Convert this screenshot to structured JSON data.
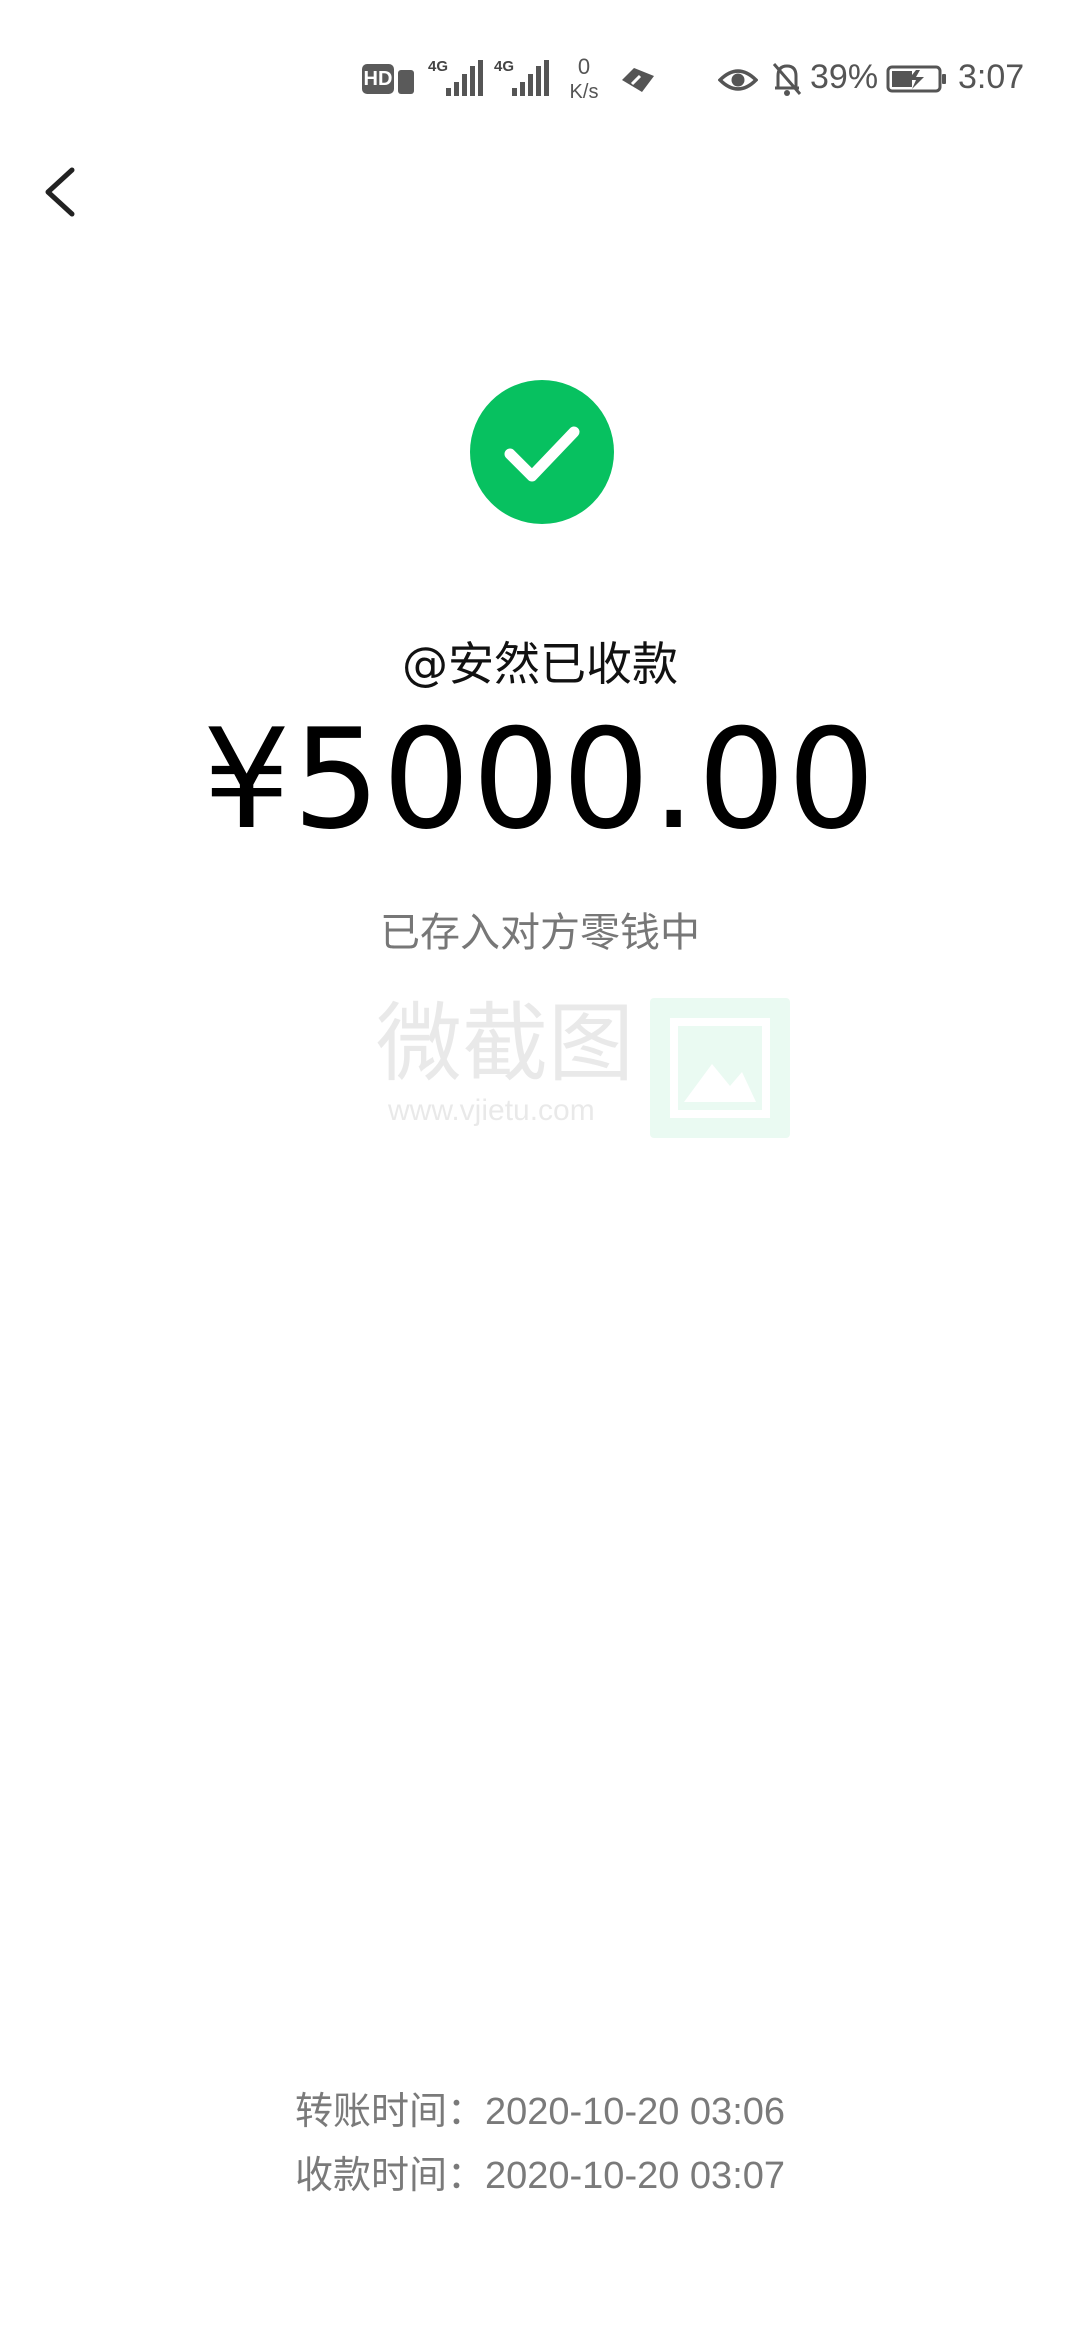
{
  "status_bar": {
    "hd_label": "HD",
    "signal_1_label": "4G",
    "signal_2_label": "4G",
    "net_speed_value": "0",
    "net_speed_unit": "K/s",
    "battery_percent": "39%",
    "time": "3:07"
  },
  "receipt": {
    "payee_line": "@安然已收款",
    "amount": "¥5000.00",
    "deposit_note": "已存入对方零钱中",
    "transfer_time_label": "转账时间：",
    "transfer_time_value": "2020-10-20 03:06",
    "receive_time_label": "收款时间：",
    "receive_time_value": "2020-10-20 03:07"
  },
  "watermark": {
    "text": "微截图",
    "url": "www.vjietu.com"
  },
  "colors": {
    "success_green": "#07c160",
    "secondary_text": "#7a7a7a"
  },
  "icons": {
    "back": "chevron-left-icon",
    "success": "check-circle-icon",
    "eye": "eye-icon",
    "mute": "bell-off-icon",
    "battery": "battery-charging-icon"
  }
}
